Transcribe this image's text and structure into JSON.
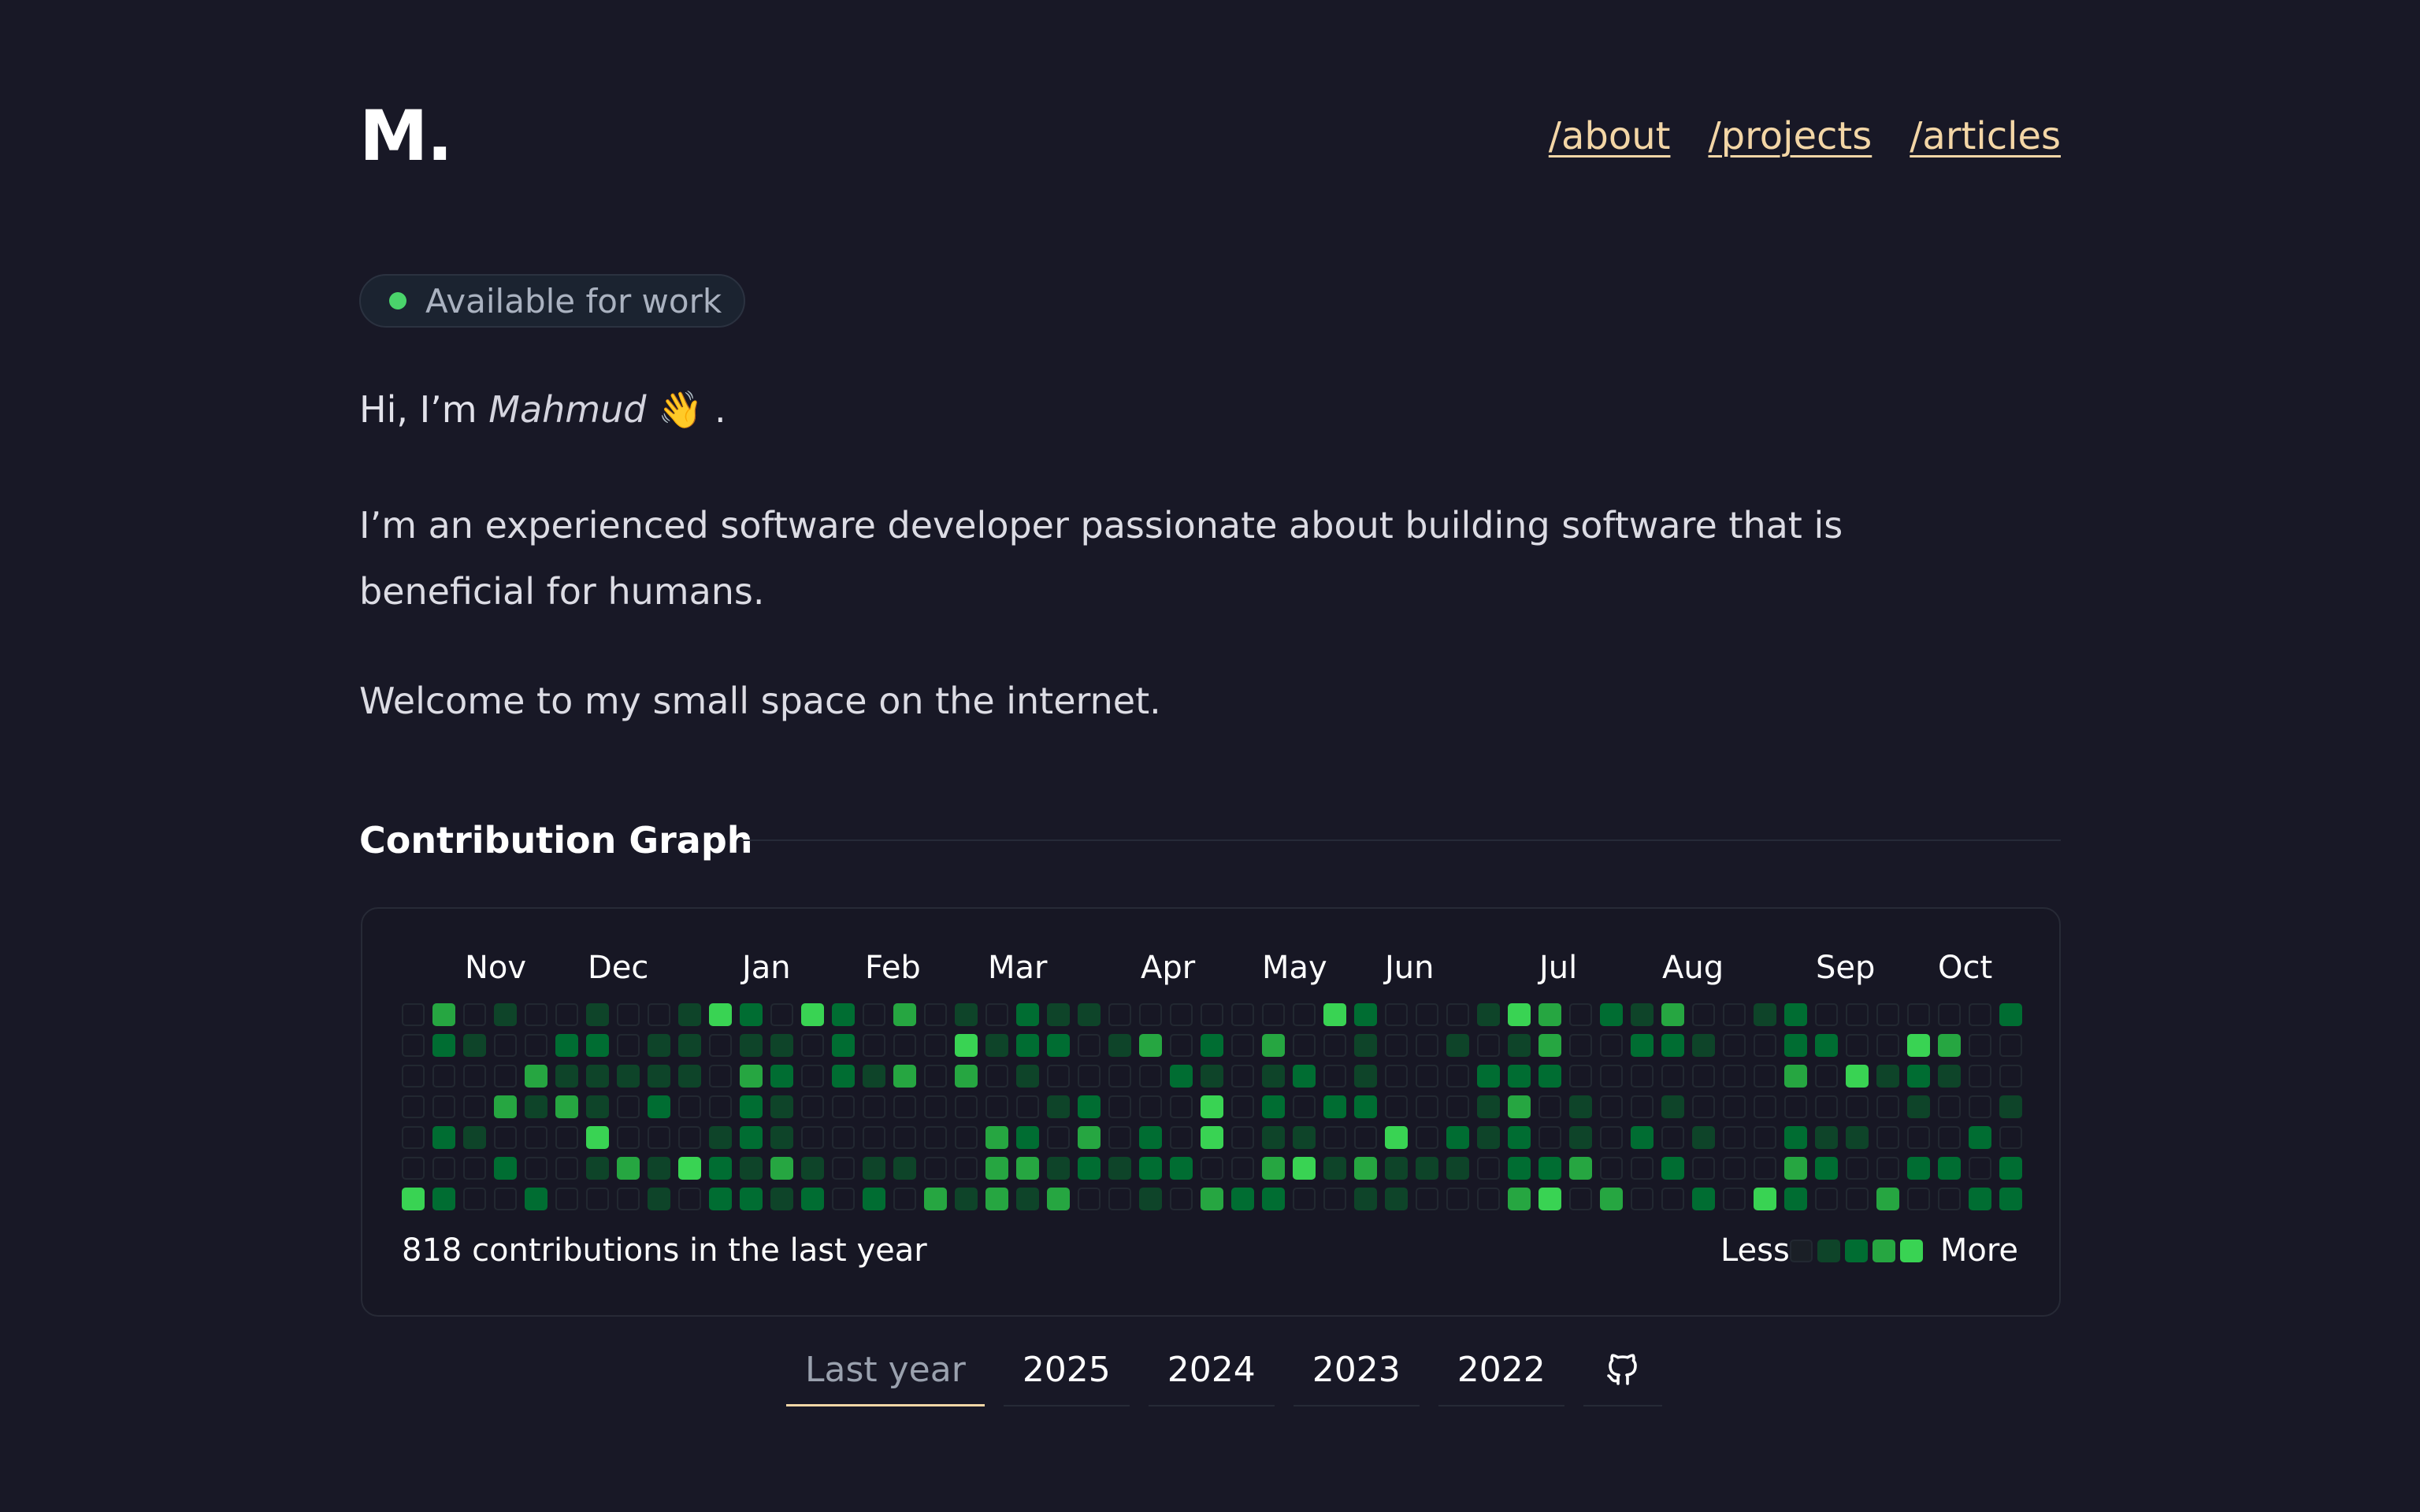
{
  "header": {
    "logo": "M.",
    "nav": [
      {
        "label": "/about"
      },
      {
        "label": "/projects"
      },
      {
        "label": "/articles"
      }
    ]
  },
  "status_badge": {
    "text": "Available for work",
    "color": "#4ad46b"
  },
  "greeting": {
    "prefix": "Hi, I’m",
    "name": "Mahmud",
    "emoji": "👋",
    "suffix": "."
  },
  "intro": "I’m an experienced software developer passionate about building software that is beneficial for humans.",
  "welcome": "Welcome to my small space on the internet.",
  "contribution_section": {
    "title": "Contribution Graph",
    "months": [
      "Nov",
      "Dec",
      "Jan",
      "Feb",
      "Mar",
      "Apr",
      "May",
      "Jun",
      "Jul",
      "Aug",
      "Sep",
      "Oct"
    ],
    "total_text": "818 contributions in the last year",
    "legend": {
      "less": "Less",
      "more": "More"
    },
    "level_colors": [
      "#1a1f26",
      "#0e4429",
      "#006d32",
      "#26a641",
      "#39d353"
    ]
  },
  "year_tabs": [
    {
      "label": "Last year",
      "active": true
    },
    {
      "label": "2025",
      "active": false
    },
    {
      "label": "2024",
      "active": false
    },
    {
      "label": "2023",
      "active": false
    },
    {
      "label": "2022",
      "active": false
    }
  ],
  "github_icon": "github-icon",
  "colors": {
    "background": "#181826",
    "accent_link": "#f3d6a6",
    "available_dot": "#4ad46b"
  }
}
